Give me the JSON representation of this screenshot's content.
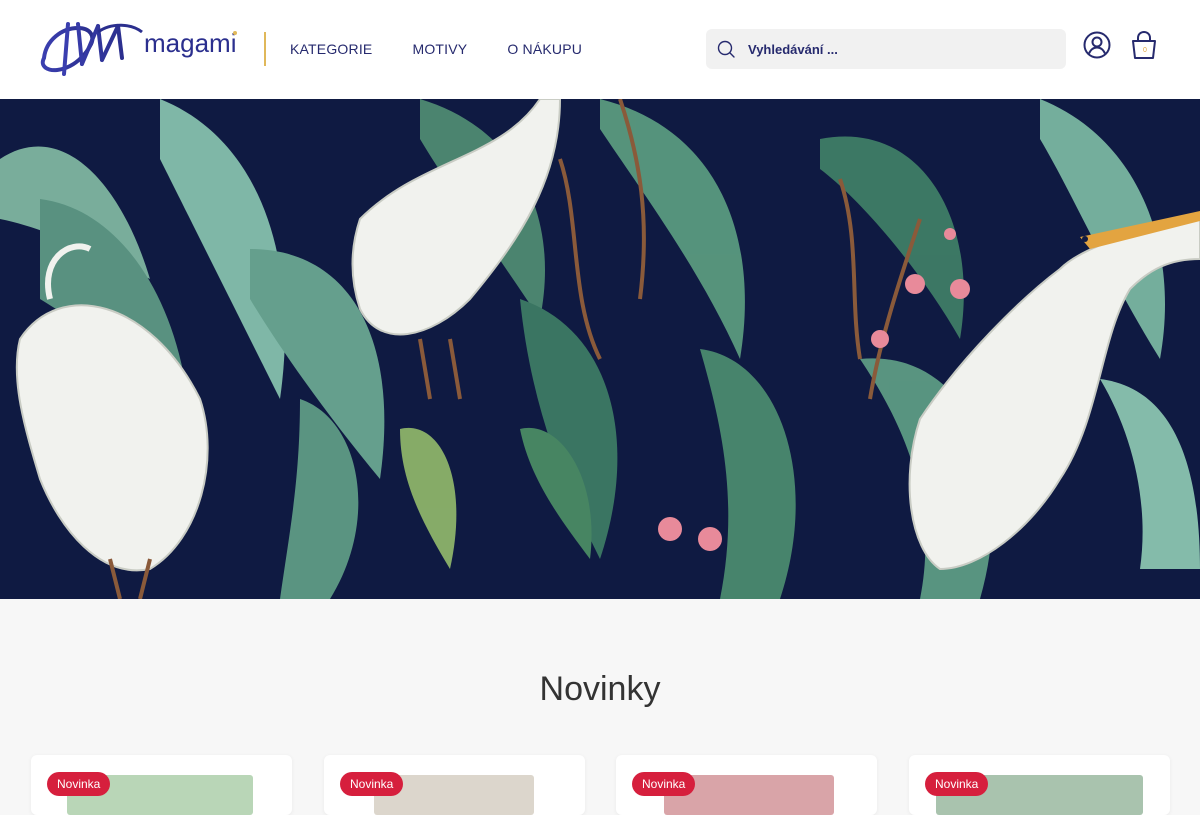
{
  "header": {
    "logo_text": "magami",
    "nav": [
      {
        "label": "KATEGORIE"
      },
      {
        "label": "MOTIVY"
      },
      {
        "label": "O NÁKUPU"
      }
    ],
    "search": {
      "placeholder": "Vyhledávání ..."
    },
    "cart_count": "0"
  },
  "colors": {
    "brand": "#262a6e",
    "accent": "#e0b85a",
    "badge": "#d61f3d",
    "hero_bg": "#0f1a42"
  },
  "hero": {
    "icon": "herons-tropical-pattern-banner"
  },
  "novinky": {
    "title": "Novinky",
    "products": [
      {
        "badge": "Novinka",
        "image": "mint-tin-box"
      },
      {
        "badge": "Novinka",
        "image": "decorated-box"
      },
      {
        "badge": "Novinka",
        "image": "floral-napkin"
      },
      {
        "badge": "Novinka",
        "image": "round-green-tin"
      }
    ]
  }
}
